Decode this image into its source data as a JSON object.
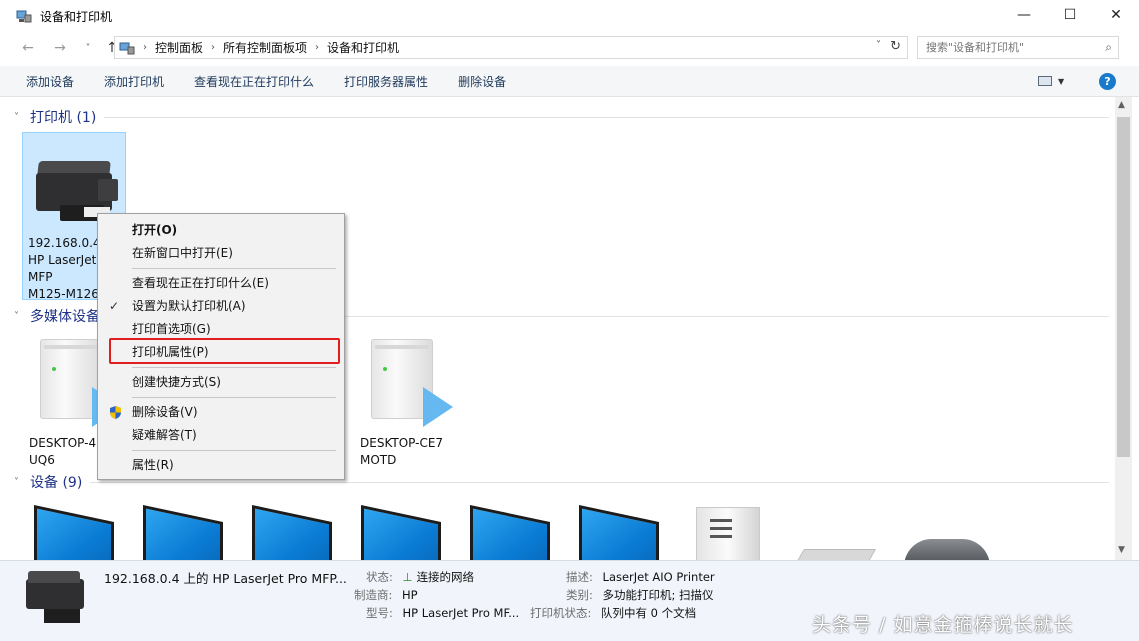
{
  "window": {
    "title": "设备和打印机",
    "minimize": "—",
    "maximize": "☐",
    "close": "✕"
  },
  "address": {
    "back": "←",
    "forward": "→",
    "up": "↑",
    "crumbs": [
      "控制面板",
      "所有控制面板项",
      "设备和打印机"
    ],
    "search_placeholder": "搜索\"设备和打印机\""
  },
  "commands": [
    "添加设备",
    "添加打印机",
    "查看现在正在打印什么",
    "打印服务器属性",
    "删除设备"
  ],
  "help_label": "?",
  "groups": {
    "printers": "打印机 (1)",
    "multimedia": "多媒体设备",
    "devices": "设备 (9)"
  },
  "printer_tile": [
    "192.168.0.4",
    "HP LaserJet",
    "MFP",
    "M125-M126"
  ],
  "media_tiles": [
    [
      "DESKTOP-4",
      "UQ6"
    ],
    [
      "DESKTOP-CE7",
      "MOTD"
    ]
  ],
  "context_menu": {
    "items": [
      {
        "label": "打开(O)",
        "bold": true
      },
      {
        "label": "在新窗口中打开(E)"
      },
      {
        "label": "查看现在正在打印什么(E)"
      },
      {
        "label": "设置为默认打印机(A)",
        "checked": true
      },
      {
        "label": "打印首选项(G)"
      },
      {
        "label": "打印机属性(P)",
        "highlighted": true
      },
      {
        "label": "创建快捷方式(S)"
      },
      {
        "label": "删除设备(V)",
        "shield": true
      },
      {
        "label": "疑难解答(T)"
      },
      {
        "label": "属性(R)"
      }
    ]
  },
  "details": {
    "name": "192.168.0.4 上的 HP LaserJet Pro MFP...",
    "status_label": "状态:",
    "status_value": "连接的网络",
    "maker_label": "制造商:",
    "maker_value": "HP",
    "model_label": "型号:",
    "model_value": "HP LaserJet Pro MF...",
    "desc_label": "描述:",
    "desc_value": "LaserJet AIO Printer",
    "category_label": "类别:",
    "category_value": "多功能打印机; 扫描仪",
    "printstate_label": "打印机状态:",
    "printstate_value": "队列中有 0 个文档"
  },
  "watermark": "头条号 / 如意金箍棒说长就长",
  "colors": {
    "accent": "#1979ca",
    "group_title": "#1e3287",
    "selection": "#cce8ff",
    "highlight_border": "#e01e1e"
  }
}
